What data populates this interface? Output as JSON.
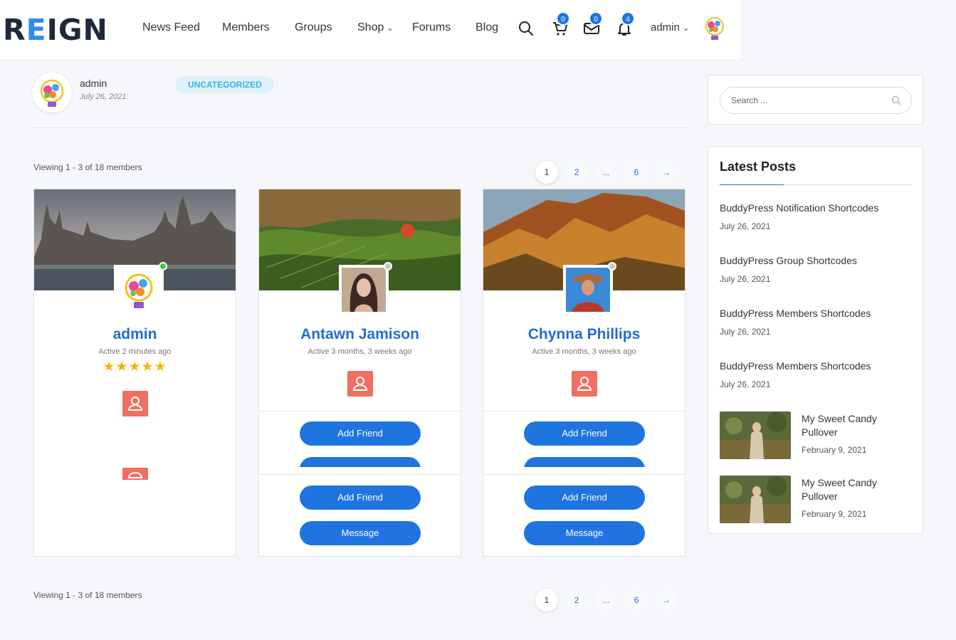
{
  "header": {
    "logo_pre": "R",
    "logo_e": "E",
    "logo_post": "IGN",
    "nav": [
      "News Feed",
      "Members",
      "Groups",
      "Shop",
      "Forums",
      "Blog"
    ],
    "cart_count": "0",
    "messages_count": "0",
    "notifications_count": "4",
    "user_name": "admin"
  },
  "post_meta": {
    "author": "admin",
    "date": "July 26, 2021",
    "category": "Uncategorized"
  },
  "members": {
    "viewing_text": "Viewing 1 - 3 of 18 members",
    "pagination": [
      "1",
      "2",
      "...",
      "6",
      "→"
    ],
    "cards": [
      {
        "name": "admin",
        "active": "Active 2 minutes ago",
        "rating_stars": "★★★★★",
        "online": true
      },
      {
        "name": "Antawn Jamison",
        "active": "Active 3 months, 3 weeks ago",
        "add_friend": "Add Friend",
        "message": "Message",
        "online": false
      },
      {
        "name": "Chynna Phillips",
        "active": "Active 3 months, 3 weeks ago",
        "add_friend": "Add Friend",
        "message": "Message",
        "online": false
      }
    ]
  },
  "sidebar": {
    "search_placeholder": "Search ...",
    "latest_title": "Latest Posts",
    "posts": [
      {
        "title": "BuddyPress Notification Shortcodes",
        "date": "July 26, 2021"
      },
      {
        "title": "BuddyPress Group Shortcodes",
        "date": "July 26, 2021"
      },
      {
        "title": "BuddyPress Members Shortcodes",
        "date": "July 26, 2021"
      },
      {
        "title": "BuddyPress Members Shortcodes",
        "date": "July 26, 2021"
      }
    ],
    "thumb_posts": [
      {
        "title": "My Sweet Candy Pullover",
        "date": "February 9, 2021"
      },
      {
        "title": "My Sweet Candy Pullover",
        "date": "February 9, 2021"
      }
    ]
  },
  "colors": {
    "accent": "#1f74e0",
    "profile_button": "#ef6f61",
    "online": "#3cc83c",
    "offline": "#c8c8c8",
    "star": "#f7b500"
  },
  "icons": [
    "search-icon",
    "cart-icon",
    "mail-icon",
    "bell-icon",
    "chevron-down-icon",
    "user-icon",
    "lightbulb-logo-icon"
  ]
}
